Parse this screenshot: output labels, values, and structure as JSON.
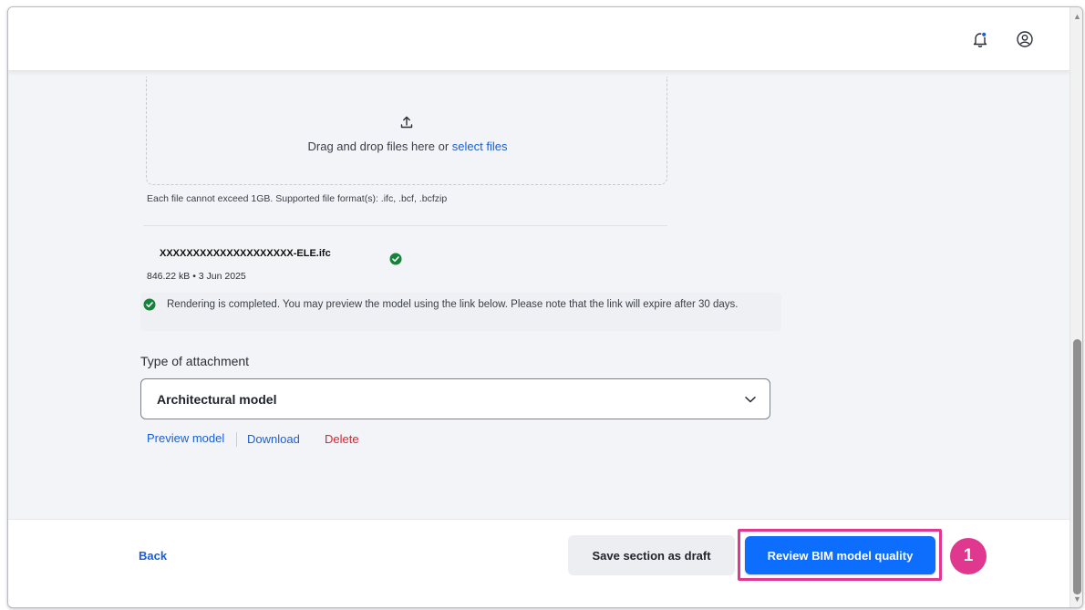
{
  "header": {
    "notification_icon": "bell-icon",
    "user_icon": "user-circle-icon",
    "notification_dot_color": "#1a5fd6"
  },
  "upload": {
    "icon": "upload-icon",
    "prompt": "Drag and drop files here or ",
    "select_link": "select files",
    "note": "Each file cannot exceed 1GB. Supported file format(s): .ifc, .bcf, .bcfzip"
  },
  "file": {
    "name": "XXXXXXXXXXXXXXXXXXXX-ELE.ifc",
    "meta": "846.22 kB • 3 Jun 2025",
    "status_icon": "check-circle-icon",
    "render_message": "Rendering is completed. You may preview the model using the link below. Please note that the link will expire after 30 days."
  },
  "attachment": {
    "label": "Type of attachment",
    "selected": "Architectural model"
  },
  "actions": {
    "preview": "Preview model",
    "download": "Download",
    "delete": "Delete"
  },
  "footer": {
    "back": "Back",
    "save_draft": "Save section as draft",
    "review": "Review BIM model quality",
    "step": "1"
  },
  "colors": {
    "primary": "#0d6efd",
    "link": "#1a5fd6",
    "danger": "#d7262f",
    "success": "#16833a",
    "highlight": "#e0388f"
  }
}
